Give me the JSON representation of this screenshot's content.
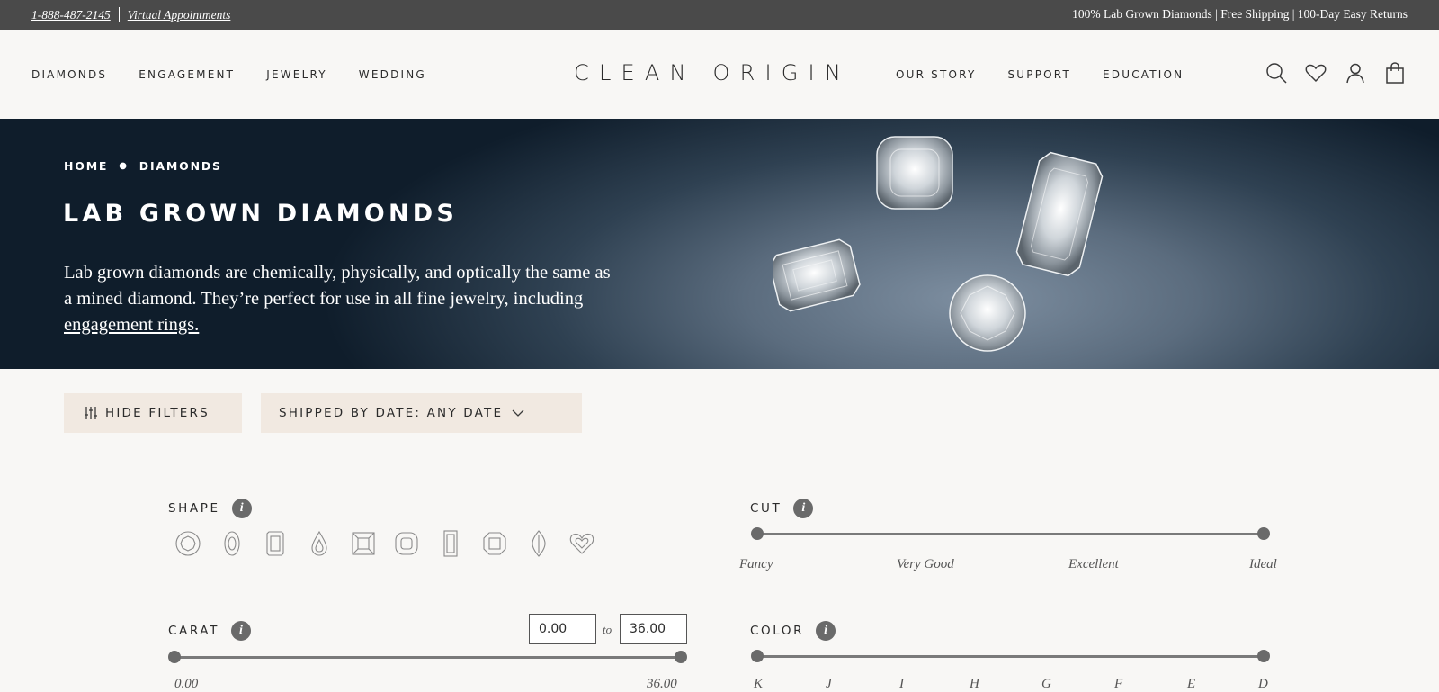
{
  "topbar": {
    "phone": "1-888-487-2145",
    "appointments": "Virtual Appointments",
    "promo": "100% Lab Grown Diamonds | Free Shipping | 100-Day Easy Returns"
  },
  "header": {
    "logo": "CLEAN ORIGIN",
    "nav_left": [
      "DIAMONDS",
      "ENGAGEMENT",
      "JEWELRY",
      "WEDDING"
    ],
    "nav_right": [
      "OUR STORY",
      "SUPPORT",
      "EDUCATION"
    ],
    "icons": [
      "search-icon",
      "heart-icon",
      "account-icon",
      "bag-icon"
    ]
  },
  "hero": {
    "breadcrumb": [
      "HOME",
      "DIAMONDS"
    ],
    "title": "LAB GROWN DIAMONDS",
    "description": "Lab grown diamonds are chemically, physically, and optically the same as a mined diamond. They’re perfect for use in all fine jewelry, including ",
    "link_text": "engagement rings."
  },
  "filters_bar": {
    "hide_filters": "HIDE FILTERS",
    "shipped_by": "SHIPPED BY DATE: ANY DATE"
  },
  "filters": {
    "shape": {
      "label": "SHAPE",
      "options": [
        "round",
        "oval",
        "emerald",
        "pear",
        "princess",
        "cushion",
        "radiant-elongated",
        "asscher",
        "marquise",
        "heart"
      ]
    },
    "cut": {
      "label": "CUT",
      "ticks": [
        "Fancy",
        "Very Good",
        "Excellent",
        "Ideal"
      ],
      "range": [
        0,
        1
      ]
    },
    "carat": {
      "label": "CARAT",
      "min_value": "0.00",
      "max_value": "36.00",
      "to_label": "to",
      "ticks": [
        "0.00",
        "36.00"
      ],
      "range": [
        0,
        1
      ]
    },
    "color": {
      "label": "COLOR",
      "ticks": [
        "K",
        "J",
        "I",
        "H",
        "G",
        "F",
        "E",
        "D"
      ],
      "range": [
        0,
        1
      ]
    }
  },
  "colors": {
    "topbar": "#4a4a4a",
    "button_bg": "#f1e9e1",
    "slider": "#6a6a6a"
  }
}
